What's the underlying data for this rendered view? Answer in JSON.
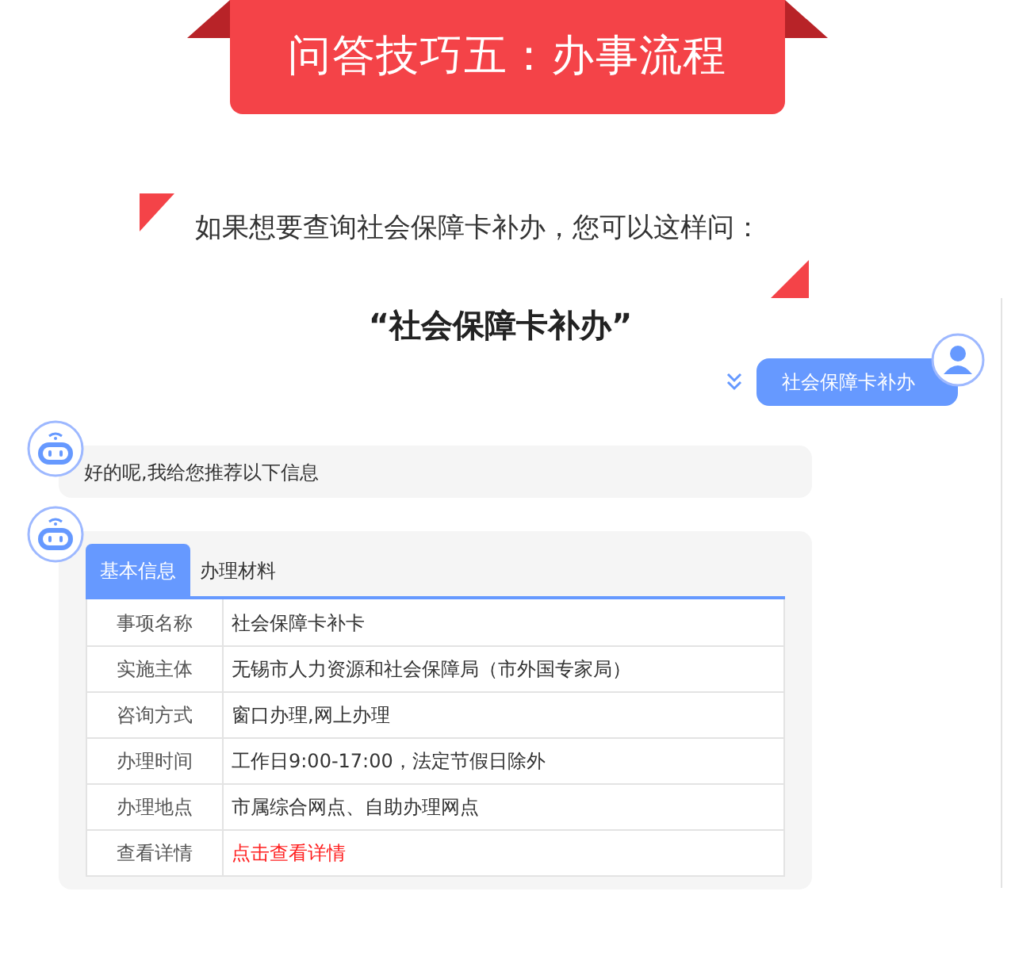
{
  "banner": {
    "title": "问答技巧五：办事流程"
  },
  "intro": "如果想要查询社会保障卡补办，您可以这样问：",
  "query": "“社会保障卡补办”",
  "chat": {
    "user_message": "社会保障卡补办",
    "bot_reply": "好的呢,我给您推荐以下信息",
    "tabs": [
      {
        "label": "基本信息",
        "selected": true
      },
      {
        "label": "办理材料",
        "selected": false
      }
    ],
    "rows": [
      {
        "label": "事项名称",
        "value": "社会保障卡补卡",
        "kind": "text"
      },
      {
        "label": "实施主体",
        "value": "无锡市人力资源和社会保障局（市外国专家局）",
        "kind": "text"
      },
      {
        "label": "咨询方式",
        "value": "窗口办理,网上办理",
        "kind": "text"
      },
      {
        "label": "办理时间",
        "value": "工作日9:00-17:00，法定节假日除外",
        "kind": "text"
      },
      {
        "label": "办理地点",
        "value": "市属综合网点、自助办理网点",
        "kind": "text"
      },
      {
        "label": "查看详情",
        "value": "点击查看详情",
        "kind": "link"
      }
    ]
  }
}
